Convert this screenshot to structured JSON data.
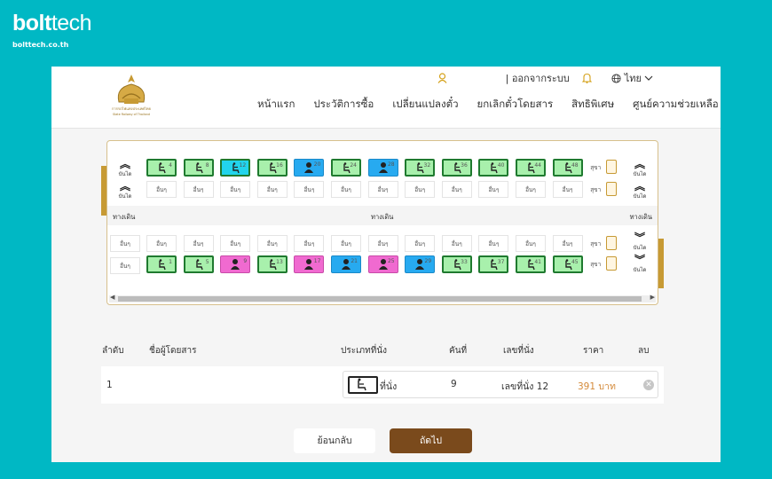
{
  "brand": {
    "logo_bold": "bolt",
    "logo_light": "tech",
    "domain": "bolttech.co.th"
  },
  "header": {
    "emblem_text_th": "การรถไฟแห่งประเทศไทย",
    "emblem_text_en": "State Railway of Thailand",
    "logout": "| ออกจากระบบ",
    "language": "ไทย",
    "nav": [
      "หน้าแรก",
      "ประวัติการซื้อ",
      "เปลี่ยนแปลงตั๋ว",
      "ยกเลิกตั๋วโดยสาร",
      "สิทธิพิเศษ",
      "ศูนย์ความช่วยเหลือ"
    ]
  },
  "coach": {
    "aisle_label": "ทางเดิน",
    "luggage_label": "อื่นๆ",
    "toilet_label": "สุขา",
    "up_label": "บันได",
    "down_label": "บันได",
    "top_seats": [
      {
        "num": "4",
        "type": "std"
      },
      {
        "num": "8",
        "type": "std"
      },
      {
        "num": "12",
        "type": "sel"
      },
      {
        "num": "16",
        "type": "std"
      },
      {
        "num": "20",
        "type": "m"
      },
      {
        "num": "24",
        "type": "std"
      },
      {
        "num": "28",
        "type": "m"
      },
      {
        "num": "32",
        "type": "std"
      },
      {
        "num": "36",
        "type": "std"
      },
      {
        "num": "40",
        "type": "std"
      },
      {
        "num": "44",
        "type": "std"
      },
      {
        "num": "48",
        "type": "std"
      }
    ],
    "bottom_seats": [
      {
        "num": "1",
        "type": "std"
      },
      {
        "num": "5",
        "type": "std"
      },
      {
        "num": "9",
        "type": "f"
      },
      {
        "num": "13",
        "type": "std"
      },
      {
        "num": "17",
        "type": "f"
      },
      {
        "num": "21",
        "type": "m"
      },
      {
        "num": "25",
        "type": "f"
      },
      {
        "num": "29",
        "type": "m"
      },
      {
        "num": "33",
        "type": "std"
      },
      {
        "num": "37",
        "type": "std"
      },
      {
        "num": "41",
        "type": "std"
      },
      {
        "num": "45",
        "type": "std"
      }
    ]
  },
  "table": {
    "headers": {
      "order": "ลำดับ",
      "name": "ชื่อผู้โดยสาร",
      "seat_type": "ประเภทที่นั่ง",
      "car": "คันที่",
      "seat_no": "เลขที่นั่ง",
      "price": "ราคา",
      "delete": "ลบ"
    },
    "rows": [
      {
        "order": "1",
        "name": "",
        "seat_type": "ที่นั่ง",
        "car": "9",
        "seat_no": "เลขที่นั่ง 12",
        "price": "391 บาท"
      }
    ]
  },
  "buttons": {
    "back": "ย้อนกลับ",
    "next": "ถัดไป"
  },
  "colors": {
    "background": "#00b8c4",
    "accent": "#7a4a1c",
    "seat_available": "#a8f0ac",
    "seat_selected": "#22d4ec",
    "seat_male": "#27aaf0",
    "seat_female": "#f06ad0",
    "price": "#d48a3a"
  },
  "icons": {
    "user": "user-icon",
    "bell": "bell-icon",
    "globe": "globe-icon",
    "chevron": "chevron-down-icon",
    "remove": "remove-icon"
  }
}
